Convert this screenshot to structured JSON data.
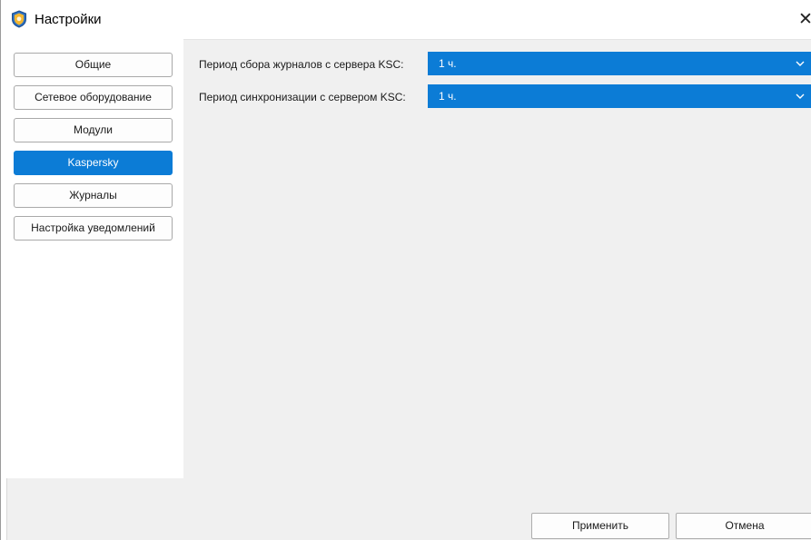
{
  "window": {
    "title": "Настройки",
    "app_icon": "shield-icon",
    "close_icon": "close-icon",
    "close_glyph": "✕"
  },
  "sidebar": {
    "items": [
      {
        "label": "Общие",
        "active": false
      },
      {
        "label": "Сетевое оборудование",
        "active": false
      },
      {
        "label": "Модули",
        "active": false
      },
      {
        "label": "Kaspersky",
        "active": true
      },
      {
        "label": "Журналы",
        "active": false
      },
      {
        "label": "Настройка уведомлений",
        "active": false
      }
    ]
  },
  "settings": {
    "log_collection": {
      "label": "Период сбора журналов с сервера KSC:",
      "value": "1 ч."
    },
    "sync": {
      "label": "Период синхронизации с сервером KSC:",
      "value": "1 ч."
    }
  },
  "footer": {
    "apply_label": "Применить",
    "cancel_label": "Отмена"
  },
  "colors": {
    "accent": "#0c7cd6",
    "panel_background": "#f0f0f0"
  }
}
